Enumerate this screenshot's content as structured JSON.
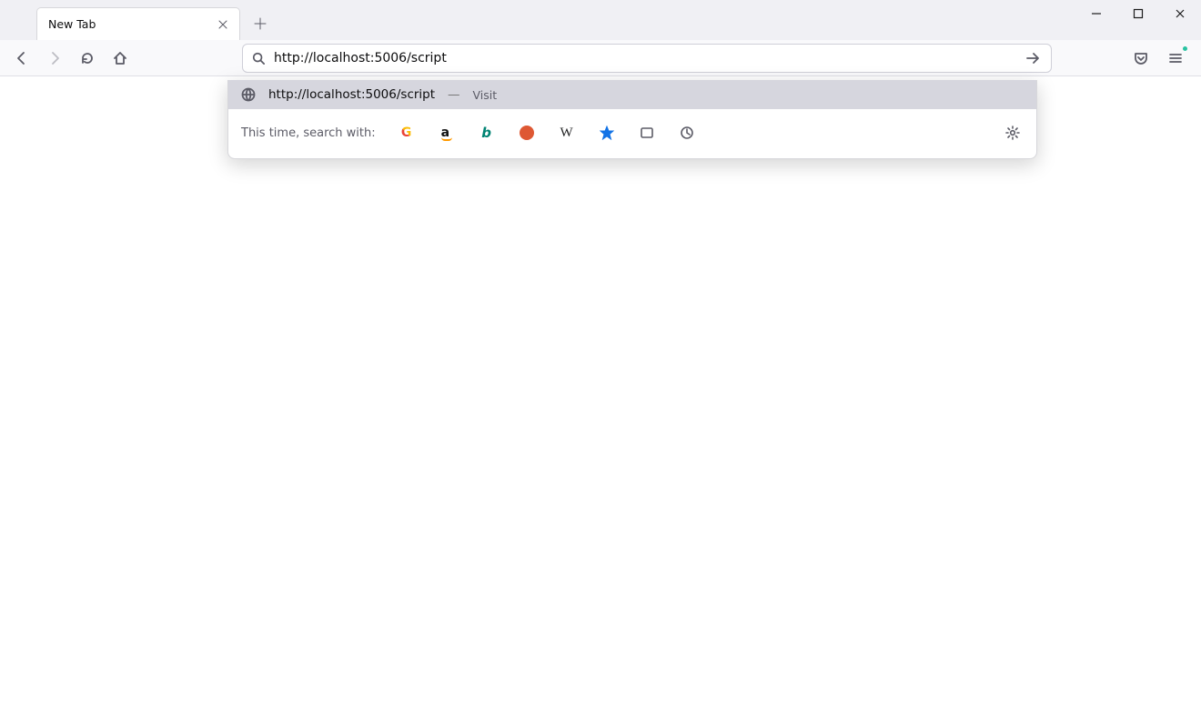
{
  "tab": {
    "title": "New Tab"
  },
  "urlbar": {
    "value": "http://localhost:5006/script"
  },
  "suggestion": {
    "url": "http://localhost:5006/script",
    "separator": "—",
    "action": "Visit"
  },
  "search_row": {
    "label": "This time, search with:"
  },
  "engines": {
    "google": "G",
    "amazon": "a",
    "bing": "b",
    "duckduckgo": "",
    "wikipedia": "W"
  }
}
